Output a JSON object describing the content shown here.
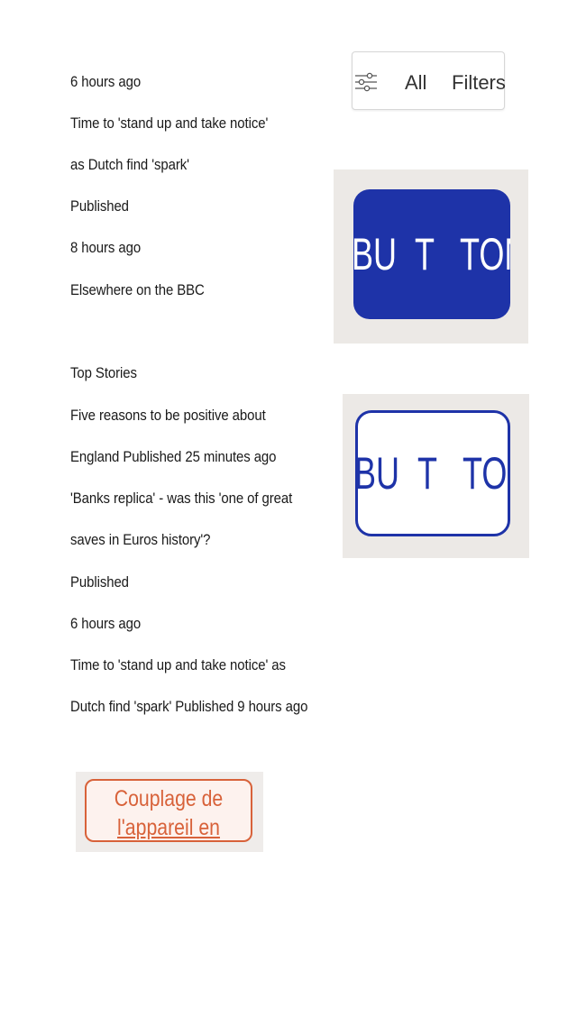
{
  "filter_bar": {
    "all_label": "All",
    "filters_label": "Filters",
    "icon": "sliders-icon"
  },
  "feed_lines": [
    "6 hours ago",
    "Time to 'stand up and take notice'",
    "as Dutch find 'spark'",
    "Published",
    "8 hours ago",
    "Elsewhere on the BBC",
    "Top Stories",
    "Five reasons to be positive about",
    "England Published 25 minutes ago",
    "'Banks replica' - was this 'one of great",
    "saves in Euros history'?",
    "Published",
    "6 hours ago",
    "Time to 'stand up and take notice' as",
    "Dutch find 'spark' Published 9 hours ago"
  ],
  "button_images": [
    {
      "style": "filled",
      "parts": [
        "BU",
        "T",
        "TON"
      ],
      "color": "#1e33a8",
      "text_color": "#ffffff"
    },
    {
      "style": "outline",
      "parts": [
        "BU",
        "T",
        "TON"
      ],
      "color": "#1e33a8",
      "text_color": "#1e33a8"
    }
  ],
  "couplage_button": {
    "line1": "Couplage de",
    "line2": "l'appareil en cours",
    "color": "#d8623a"
  }
}
